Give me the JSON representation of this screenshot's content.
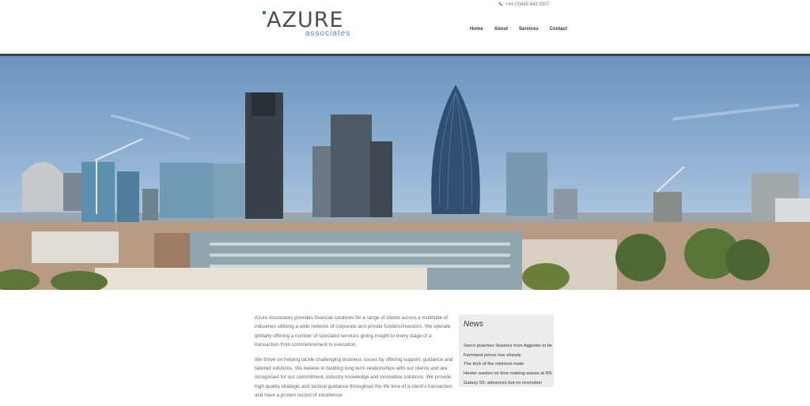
{
  "logo": {
    "main": "AZURE",
    "sub": "associates"
  },
  "header": {
    "phone": "+44 (0)845 643 9307",
    "nav": [
      "Home",
      "About",
      "Services",
      "Contact"
    ]
  },
  "hero": {
    "image": "london-city-skyline-photo"
  },
  "intro": {
    "paragraphs": [
      "Azure Associates provides financial solutions for a range of clients across a multitude of industries utilising a wide network of corporate and private funders/investors. We operate globally offering a number of specialist services giving insight to every stage of a transaction from commencement to execution.",
      "We thrive on helping tackle challenging business issues by offering support, guidance and tailored solutions. We believe in building long term relationships with our clients and are recognised for our commitment, industry knowledge and innovative solutions. We provide high quality strategic and tactical guidance throughout the life time of a client's transaction and have a proven record of excellence."
    ]
  },
  "news": {
    "title": "News",
    "items": [
      "Serco poaches Soames from Aggreko to be",
      "Farmland prices rise sharply",
      "The trick of the mistress trade",
      "Hester wastes no time making waves at RS",
      "Galaxy S5: advances but no revolution"
    ]
  },
  "colors": {
    "accent": "#4a8ad0",
    "logo_text": "#4d4d4d",
    "news_bg": "#ececec"
  }
}
